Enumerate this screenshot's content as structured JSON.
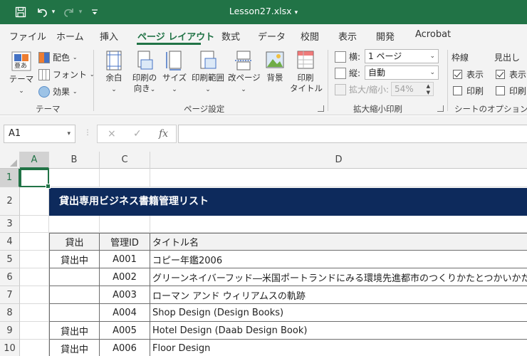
{
  "app": {
    "title": "Lesson27.xlsx",
    "accent_color": "#217346",
    "band_color": "#0d2a5c"
  },
  "quick_access": {
    "save_icon": "save-icon",
    "undo_icon": "undo-icon",
    "redo_icon": "redo-icon",
    "customize_icon": "customize-qat-icon"
  },
  "tabs": [
    {
      "label": "ファイル"
    },
    {
      "label": "ホーム"
    },
    {
      "label": "挿入"
    },
    {
      "label": "ページ レイアウト"
    },
    {
      "label": "数式"
    },
    {
      "label": "データ"
    },
    {
      "label": "校閲"
    },
    {
      "label": "表示"
    },
    {
      "label": "開発"
    },
    {
      "label": "Acrobat"
    }
  ],
  "ribbon": {
    "theme_group": {
      "label": "テーマ",
      "theme_button": "テーマ",
      "colors": "配色",
      "fonts": "フォント",
      "effects": "効果"
    },
    "page_setup_group": {
      "label": "ページ設定",
      "margins": "余白",
      "orientation_line1": "印刷の",
      "orientation_line2": "向き",
      "size": "サイズ",
      "print_area": "印刷範囲",
      "breaks": "改ページ",
      "background": "背景",
      "print_titles_line1": "印刷",
      "print_titles_line2": "タイトル"
    },
    "scale_group": {
      "label": "拡大縮小印刷",
      "width_label": "横:",
      "width_value": "1 ページ",
      "height_label": "縦:",
      "height_value": "自動",
      "scale_label": "拡大/縮小:",
      "scale_value": "54%"
    },
    "sheet_options_group": {
      "label": "シートのオプション",
      "gridlines_header": "枠線",
      "headings_header": "見出し",
      "view_label": "表示",
      "print_label": "印刷",
      "gridlines_view": true,
      "gridlines_print": false,
      "headings_view": true,
      "headings_print": false
    }
  },
  "formula_bar": {
    "name_box": "A1",
    "cancel_icon": "×",
    "enter_icon": "✓",
    "fx_label": "fx",
    "formula": ""
  },
  "sheet": {
    "columns": [
      "A",
      "B",
      "C",
      "D"
    ],
    "rows": [
      "1",
      "2",
      "3",
      "4",
      "5",
      "6",
      "7",
      "8",
      "9",
      "10"
    ],
    "title": "貸出専用ビジネス書籍管理リスト",
    "headers": {
      "b": "貸出",
      "c": "管理ID",
      "d": "タイトル名"
    },
    "records": [
      {
        "b": "貸出中",
        "c": "A001",
        "d": "コピー年鑑2006"
      },
      {
        "b": "",
        "c": "A002",
        "d": "グリーンネイバーフッド―米国ポートランドにみる環境先進都市のつくりかたとつかいかた"
      },
      {
        "b": "",
        "c": "A003",
        "d": "ローマン アンド ウィリアムスの軌跡"
      },
      {
        "b": "",
        "c": "A004",
        "d": "Shop Design (Design Books)"
      },
      {
        "b": "貸出中",
        "c": "A005",
        "d": "Hotel Design (Daab Design Book)"
      },
      {
        "b": "貸出中",
        "c": "A006",
        "d": "Floor Design"
      }
    ]
  }
}
